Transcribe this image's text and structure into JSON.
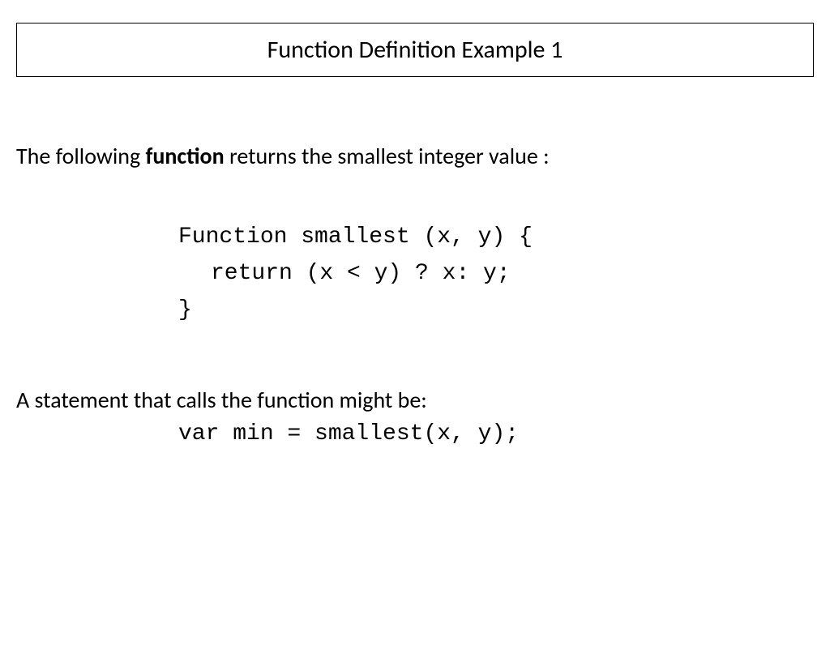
{
  "title": "Function Definition Example 1",
  "intro_pre": "The following ",
  "intro_bold": "function",
  "intro_post": " returns the smallest integer value :",
  "code": {
    "line1": "Function smallest (x, y) {",
    "line2": "return (x < y) ? x: y;",
    "line3": "}"
  },
  "call_intro": "A statement that calls the function might be:",
  "call_code": "var min = smallest(x, y);"
}
